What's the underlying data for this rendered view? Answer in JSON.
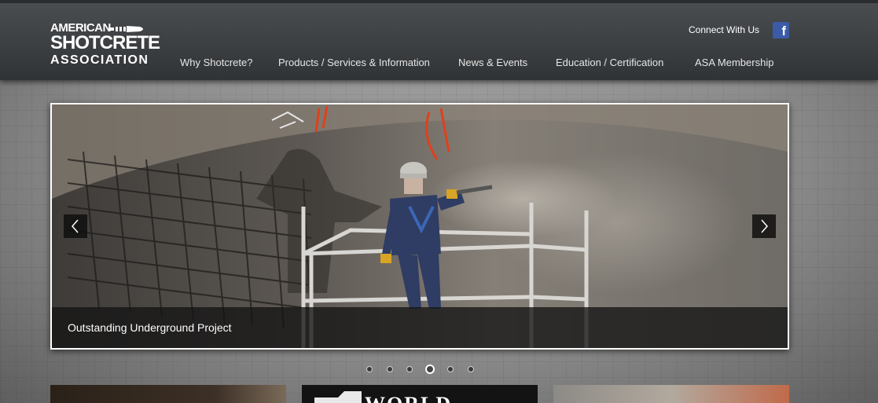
{
  "header": {
    "logo": {
      "line1": "AMERICAN",
      "line2": "SHOTCRETE",
      "line3": "ASSOCIATION"
    },
    "connect_label": "Connect With Us",
    "facebook_glyph": "f",
    "facebook_icon": "facebook-icon"
  },
  "nav": {
    "items": [
      {
        "label": "Why Shotcrete?"
      },
      {
        "label": "Products / Services & Information"
      },
      {
        "label": "News & Events"
      },
      {
        "label": "Education / Certification"
      },
      {
        "label": "ASA Membership"
      }
    ]
  },
  "slider": {
    "caption": "Outstanding Underground Project",
    "prev_icon": "chevron-left-icon",
    "next_icon": "chevron-right-icon",
    "slide_count": 6,
    "active_slide": 4
  },
  "tiles": {
    "tile2_text": "WORLD"
  },
  "colors": {
    "header_bg": "#3b3e41",
    "facebook_blue": "#3b5ba7",
    "caption_bg": "#141414",
    "nav_text": "#e6e6e6"
  }
}
